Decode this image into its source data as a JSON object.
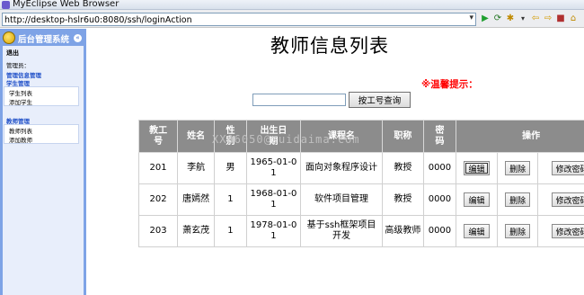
{
  "window": {
    "title": "MyEclipse Web Browser"
  },
  "browser": {
    "url": "http://desktop-hslr6u0:8080/ssh/loginAction",
    "url_dropdown": "▾",
    "toolbar_icons": [
      "go-icon",
      "run-icon",
      "refresh-icon",
      "back-icon",
      "forward-icon",
      "stop-icon",
      "home-icon"
    ]
  },
  "sidebar": {
    "title": "后台管理系统",
    "collapse_glyph": "«",
    "logout": "退出",
    "admin_label": "管理员：",
    "menu_link": "管理信息管理",
    "student_group": "学生管理",
    "student_items": [
      "学生列表",
      "添加学生"
    ],
    "teacher_group": "教师管理",
    "teacher_items": [
      "教师列表",
      "添加教师"
    ]
  },
  "main": {
    "title": "教师信息列表",
    "tip": "※温馨提示：",
    "search": {
      "value": "",
      "button": "按工号查询"
    },
    "watermark": "XX06050@zuidaima.com"
  },
  "table": {
    "headers": [
      "教工号",
      "姓名",
      "性别",
      "出生日期",
      "课程名",
      "职称",
      "密码",
      "操作"
    ],
    "header_wrapped": [
      "教工\n号",
      "姓名",
      "性\n别",
      "出生日\n期",
      "课程名",
      "职称",
      "密\n码",
      "操作"
    ],
    "rows": [
      {
        "id": "201",
        "name": "李航",
        "gender": "男",
        "birth": "1965-01-01",
        "course": "面向对象程序设计",
        "title": "教授",
        "password": "0000"
      },
      {
        "id": "202",
        "name": "唐嫣然",
        "gender": "1",
        "birth": "1968-01-01",
        "course": "软件项目管理",
        "title": "教授",
        "password": "0000"
      },
      {
        "id": "203",
        "name": "萧玄茂",
        "gender": "1",
        "birth": "1978-01-01",
        "course": "基于ssh框架项目开发",
        "title": "高级教师",
        "password": "0000"
      }
    ],
    "actions": {
      "edit": "编辑",
      "delete": "删除",
      "change_password": "修改密码"
    }
  },
  "colors": {
    "sidebar_bg": "#7ea3e6",
    "header_bg": "#8c8c8c",
    "tip": "#ff0000",
    "link": "#2050c8"
  }
}
